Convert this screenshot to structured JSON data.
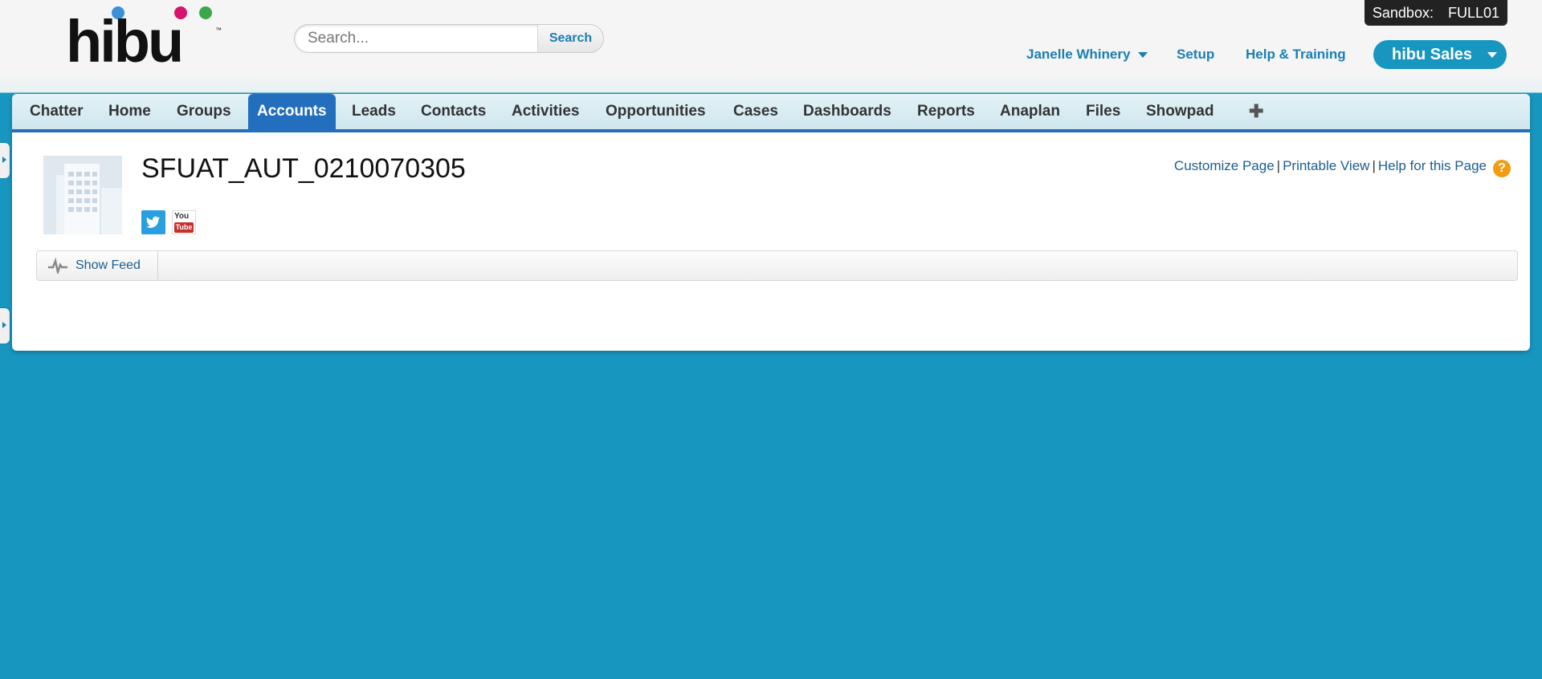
{
  "header": {
    "logo_text": "hibu",
    "search": {
      "placeholder": "Search...",
      "button_label": "Search"
    },
    "sandbox": {
      "label": "Sandbox:",
      "name": "FULL01"
    },
    "user_name": "Janelle Whinery",
    "setup_label": "Setup",
    "help_label": "Help & Training",
    "app_name": "hibu Sales"
  },
  "tabs": [
    {
      "label": "Chatter"
    },
    {
      "label": "Home"
    },
    {
      "label": "Groups"
    },
    {
      "label": "Accounts",
      "active": true
    },
    {
      "label": "Leads"
    },
    {
      "label": "Contacts"
    },
    {
      "label": "Activities"
    },
    {
      "label": "Opportunities"
    },
    {
      "label": "Cases"
    },
    {
      "label": "Dashboards"
    },
    {
      "label": "Reports"
    },
    {
      "label": "Anaplan"
    },
    {
      "label": "Files"
    },
    {
      "label": "Showpad"
    },
    {
      "label": "✚"
    }
  ],
  "record": {
    "title": "SFUAT_AUT_0210070305",
    "social": [
      "twitter-icon",
      "youtube-icon"
    ],
    "youtube_text_1": "You",
    "youtube_text_2": "Tube"
  },
  "page_links": {
    "customize": "Customize Page",
    "separator": "|",
    "printable": "Printable View",
    "help": "Help for this Page",
    "help_icon": "?"
  },
  "feed": {
    "show_label": "Show Feed"
  },
  "colors": {
    "accent": "#1797c0",
    "tab_active": "#236fbd",
    "link": "#1a7fb1"
  }
}
